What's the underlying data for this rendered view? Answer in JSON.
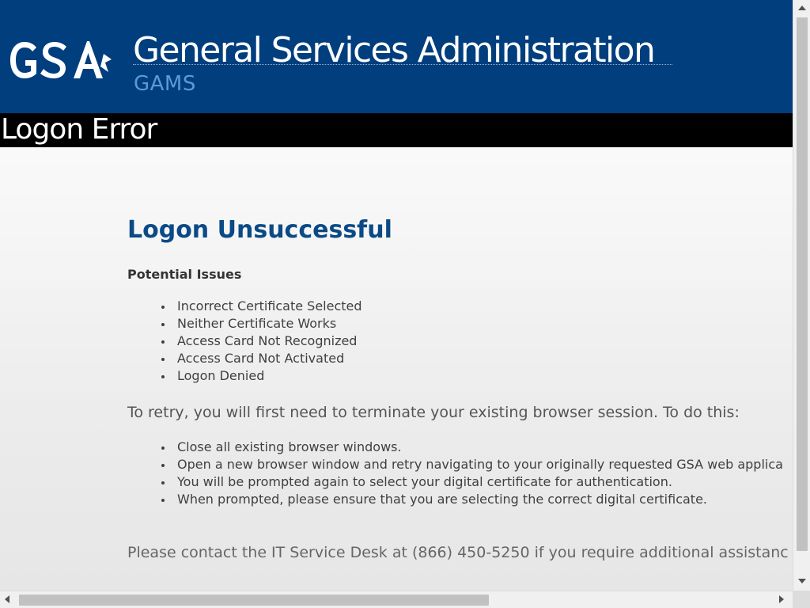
{
  "header": {
    "logo_text": "GSA",
    "agency_name": "General Services Administration",
    "app_name": "GAMS"
  },
  "page_bar": {
    "title": "Logon Error"
  },
  "main": {
    "heading": "Logon Unsuccessful",
    "issues_heading": "Potential Issues",
    "issues": [
      "Incorrect Certificate Selected",
      "Neither Certificate Works",
      "Access Card Not Recognized",
      "Access Card Not Activated",
      "Logon Denied"
    ],
    "retry_intro": "To retry, you will first need to terminate your existing browser session. To do this:",
    "steps": [
      "Close all existing browser windows.",
      "Open a new browser window and retry navigating to your originally requested GSA web applica",
      "You will be prompted again to select your digital certificate for authentication.",
      "When prompted, please ensure that you are selecting the correct digital certificate."
    ],
    "contact": "Please contact the IT Service Desk at (866) 450-5250 if you require additional assistanc"
  },
  "colors": {
    "header_bg": "#003e7e",
    "page_bar_bg": "#000000",
    "heading": "#0b4a86",
    "app_name": "#5b9ad9"
  },
  "icons": {
    "scroll_up": "arrow-up-icon",
    "scroll_down": "arrow-down-icon",
    "scroll_left": "arrow-left-icon",
    "scroll_right": "arrow-right-icon"
  }
}
